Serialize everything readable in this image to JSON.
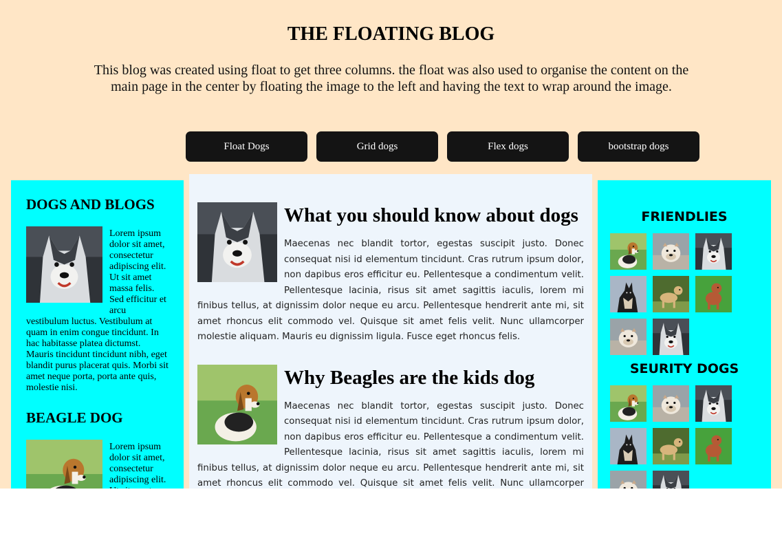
{
  "header": {
    "title": "THE FLOATING BLOG",
    "intro": "This blog was created using float to get three columns. the float was also used to organise the content on the main page in the center by floating the image to the left and having the text to wrap around the image."
  },
  "nav": {
    "items": [
      {
        "label": "Float Dogs"
      },
      {
        "label": "Grid dogs"
      },
      {
        "label": "Flex dogs"
      },
      {
        "label": "bootstrap dogs"
      }
    ]
  },
  "left_sidebar": {
    "sections": [
      {
        "heading": "DOGS AND BLOGS",
        "image": "husky-photo",
        "text": "Lorem ipsum dolor sit amet, consectetur adipiscing elit. Ut sit amet massa felis. Sed efficitur et arcu vestibulum luctus. Vestibulum at quam in enim congue tincidunt. In hac habitasse platea dictumst. Mauris tincidunt tincidunt nibh, eget blandit purus placerat quis. Morbi sit amet neque porta, porta ante quis, molestie nisi."
      },
      {
        "heading": "BEAGLE DOG",
        "image": "beagle-photo",
        "text": "Lorem ipsum dolor sit amet, consectetur adipiscing elit. Ut sit amet massa felis."
      }
    ]
  },
  "main": {
    "posts": [
      {
        "title": "What you should know about dogs",
        "image": "husky-photo",
        "text": "Maecenas nec blandit tortor, egestas suscipit justo. Donec consequat nisi id elementum tincidunt. Cras rutrum ipsum dolor, non dapibus eros efficitur eu. Pellentesque a condimentum velit. Pellentesque lacinia, risus sit amet sagittis iaculis, lorem mi finibus tellus, at dignissim dolor neque eu arcu. Pellentesque hendrerit ante mi, sit amet rhoncus elit commodo vel. Quisque sit amet felis velit. Nunc ullamcorper molestie aliquam. Mauris eu dignissim ligula. Fusce eget rhoncus felis."
      },
      {
        "title": "Why Beagles are the kids dog",
        "image": "beagle-photo",
        "text": "Maecenas nec blandit tortor, egestas suscipit justo. Donec consequat nisi id elementum tincidunt. Cras rutrum ipsum dolor, non dapibus eros efficitur eu. Pellentesque a condimentum velit. Pellentesque lacinia, risus sit amet sagittis iaculis, lorem mi finibus tellus, at dignissim dolor neque eu arcu. Pellentesque hendrerit ante mi, sit amet rhoncus elit commodo vel. Quisque sit amet felis velit. Nunc ullamcorper molestie aliquam. Mauris eu dignissim ligula. Fusce eget rhoncus felis."
      }
    ]
  },
  "right_sidebar": {
    "galleries": [
      {
        "heading": "FRIENDLIES",
        "thumbs": [
          "beagle-thumb",
          "bulldog-thumb",
          "husky-thumb",
          "german-shepherd-thumb",
          "labradoodle-thumb",
          "poodle-thumb",
          "bulldog-thumb",
          "husky-thumb"
        ]
      },
      {
        "heading": "SEURITY DOGS",
        "thumbs": [
          "beagle-thumb",
          "bulldog-thumb",
          "husky-thumb",
          "german-shepherd-thumb",
          "labradoodle-thumb",
          "poodle-thumb",
          "bulldog-thumb",
          "husky-thumb"
        ]
      }
    ]
  },
  "colors": {
    "page_background": "#ffe6c6",
    "sidebar_background": "#00ffff",
    "main_background": "#eef5fc",
    "button_background": "#141414"
  }
}
